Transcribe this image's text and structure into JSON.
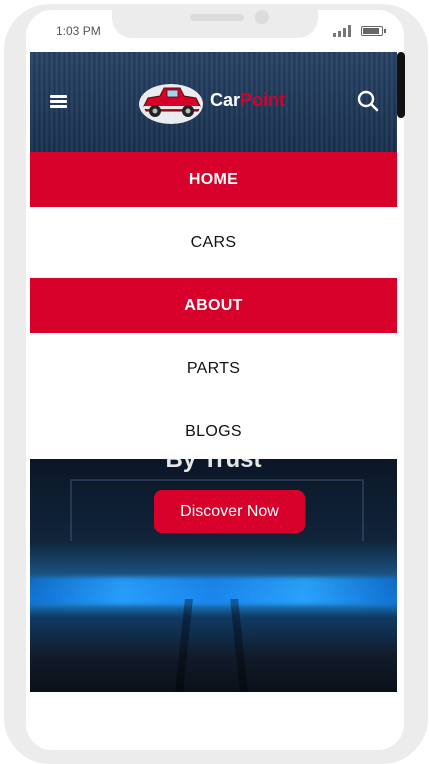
{
  "status_bar": {
    "time": "1:03 PM"
  },
  "header": {
    "logo_text_1": "Car",
    "logo_text_2": "Point",
    "menu_icon": "hamburger-icon",
    "search_icon": "search-icon"
  },
  "menu": {
    "items": [
      {
        "label": "HOME",
        "active": true
      },
      {
        "label": "CARS",
        "active": false
      },
      {
        "label": "ABOUT",
        "active": true
      },
      {
        "label": "PARTS",
        "active": false
      },
      {
        "label": "BLOGS",
        "active": false
      }
    ]
  },
  "hero": {
    "title_partial": "By Trust",
    "cta_label": "Discover Now"
  },
  "colors": {
    "accent": "#d7002a",
    "header_bg": "#223d60",
    "menu_text": "#111111"
  }
}
